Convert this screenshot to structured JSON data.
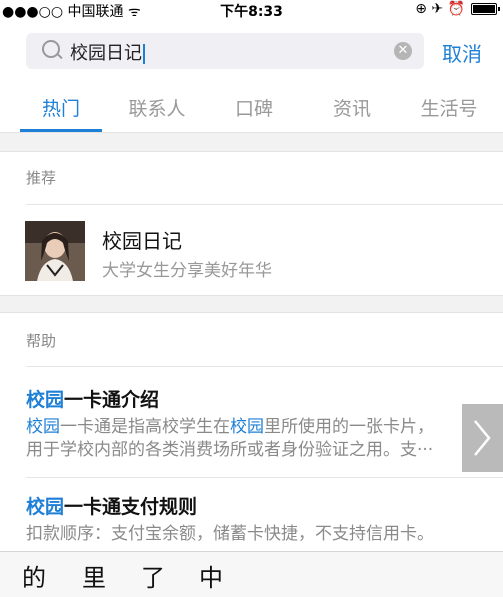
{
  "status_bar": {
    "signal": "●●●○○",
    "carrier": "中国联通",
    "wifi": "ᯤ",
    "time": "下午8:33",
    "indicators": "⊕ ✈ ⏰"
  },
  "search": {
    "value": "校园日记",
    "cancel_label": "取消"
  },
  "tabs": [
    {
      "label": "热门",
      "active": true
    },
    {
      "label": "联系人",
      "active": false
    },
    {
      "label": "口碑",
      "active": false
    },
    {
      "label": "资讯",
      "active": false
    },
    {
      "label": "生活号",
      "active": false
    }
  ],
  "recommend": {
    "section_label": "推荐",
    "item": {
      "title": "校园日记",
      "subtitle": "大学女生分享美好年华"
    }
  },
  "help": {
    "section_label": "帮助",
    "items": [
      {
        "title_highlight": "校园",
        "title_rest": "一卡通介绍",
        "desc_line1_parts": [
          "校园",
          "一卡通是指高校学生在",
          "校园",
          "里所使用的一张卡片，"
        ],
        "desc_line2": "用于学校内部的各类消费场所或者身份验证之用。支···"
      },
      {
        "title_highlight": "校园",
        "title_rest": "一卡通支付规则",
        "desc_line1": "扣款顺序：支付宝余额，储蓄卡快捷，不支持信用卡。"
      }
    ]
  },
  "keyboard_candidates": [
    "的",
    "里",
    "了",
    "中"
  ],
  "colors": {
    "accent": "#1e7fd6",
    "muted": "#999999"
  }
}
